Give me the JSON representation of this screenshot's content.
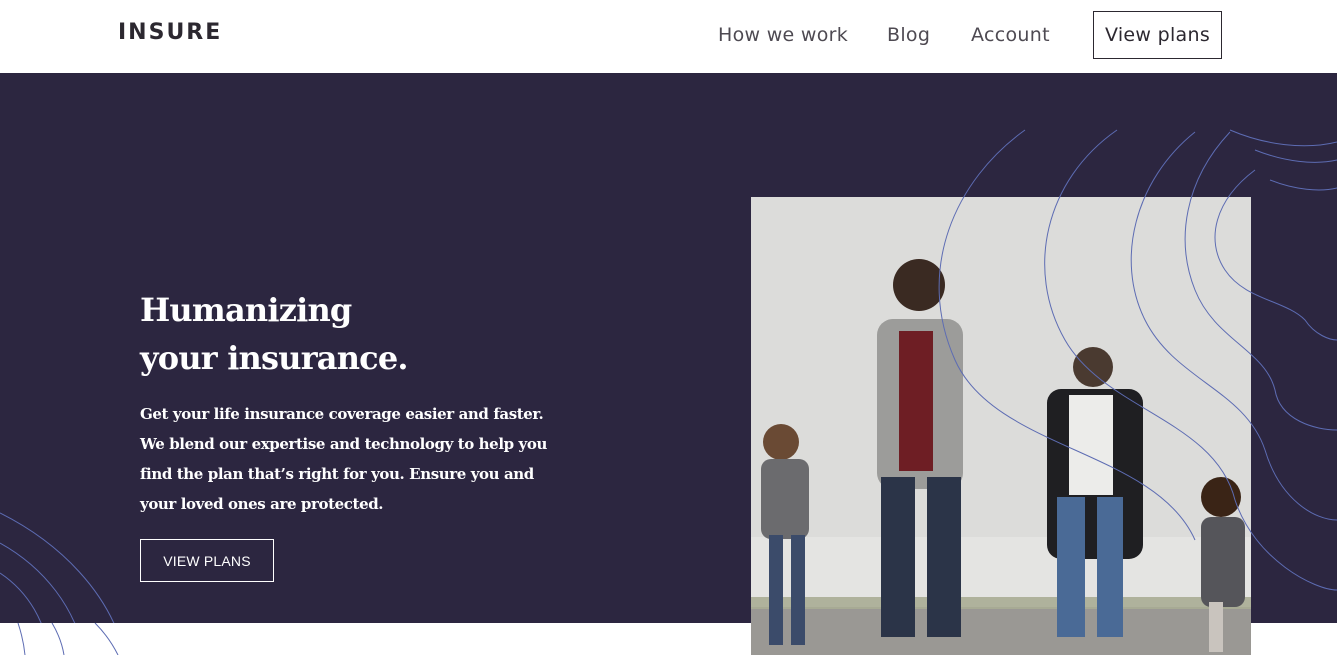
{
  "header": {
    "logo": "INSURE",
    "nav": [
      {
        "label": "How we work"
      },
      {
        "label": "Blog"
      },
      {
        "label": "Account"
      }
    ],
    "cta_label": "View plans"
  },
  "hero": {
    "title_line1": "Humanizing",
    "title_line2": "your insurance.",
    "description": "Get your life insurance coverage easier and faster. We blend our expertise and technology to help you find the plan that’s right for you. Ensure you and your loved ones are protected.",
    "button_label": "VIEW PLANS"
  },
  "colors": {
    "hero_background": "#2c2640",
    "header_background": "#ffffff",
    "text_dark": "#2c2830",
    "pattern_line": "#5d6cb3"
  }
}
